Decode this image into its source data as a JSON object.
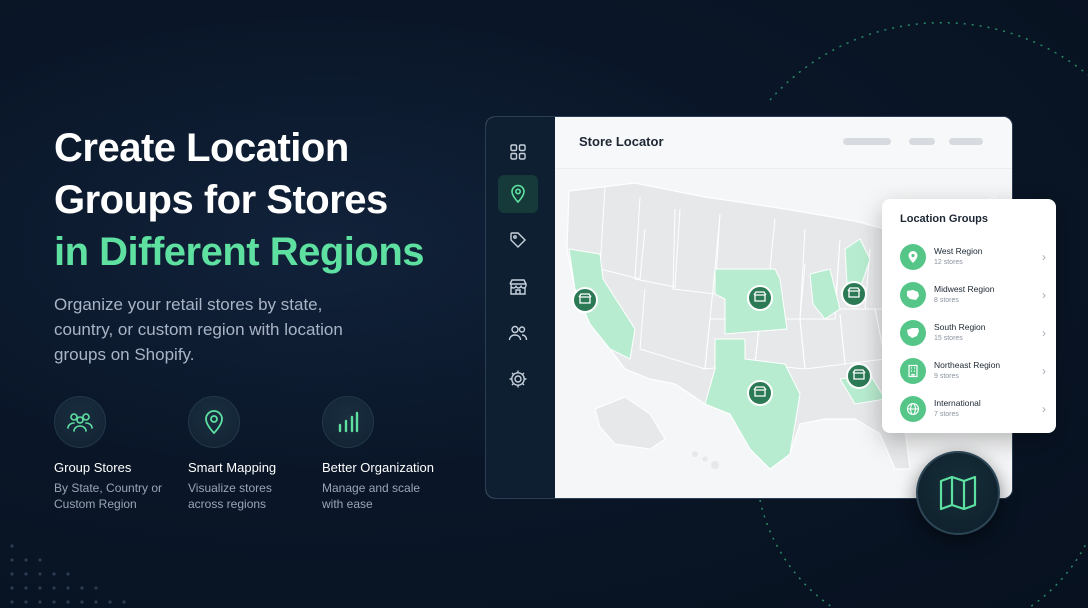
{
  "headline": {
    "line1": "Create Location",
    "line2": "Groups for Stores",
    "line3": "in Different Regions"
  },
  "subtext": "Organize your retail stores by state, country, or custom region with location groups on Shopify.",
  "features": [
    {
      "title": "Group Stores",
      "desc": "By State, Country or Custom Region",
      "icon": "group-icon"
    },
    {
      "title": "Smart Mapping",
      "desc": "Visualize stores across regions",
      "icon": "map-pin-icon"
    },
    {
      "title": "Better Organization",
      "desc": "Manage and scale with ease",
      "icon": "bar-chart-icon"
    }
  ],
  "app": {
    "title": "Store Locator",
    "sidebar": [
      {
        "name": "dashboard",
        "icon": "grid-icon",
        "active": false
      },
      {
        "name": "locations",
        "icon": "map-pin-icon",
        "active": true
      },
      {
        "name": "tags",
        "icon": "tag-icon",
        "active": false
      },
      {
        "name": "stores",
        "icon": "store-icon",
        "active": false
      },
      {
        "name": "users",
        "icon": "users-icon",
        "active": false
      },
      {
        "name": "settings",
        "icon": "gear-icon",
        "active": false
      }
    ]
  },
  "location_groups": {
    "title": "Location Groups",
    "items": [
      {
        "name": "West Region",
        "count": "12 stores",
        "icon": "map-pin-icon"
      },
      {
        "name": "Midwest Region",
        "count": "8 stores",
        "icon": "state-shape-icon"
      },
      {
        "name": "South Region",
        "count": "15 stores",
        "icon": "state-shape-icon"
      },
      {
        "name": "Northeast Region",
        "count": "9 stores",
        "icon": "building-icon"
      },
      {
        "name": "International",
        "count": "7 stores",
        "icon": "globe-icon"
      }
    ]
  },
  "colors": {
    "accent": "#5ee0a0",
    "accent_dark": "#56c688",
    "background": "#0a1628",
    "map_highlight": "#b8ecd0",
    "map_base": "#e6e8ea"
  }
}
